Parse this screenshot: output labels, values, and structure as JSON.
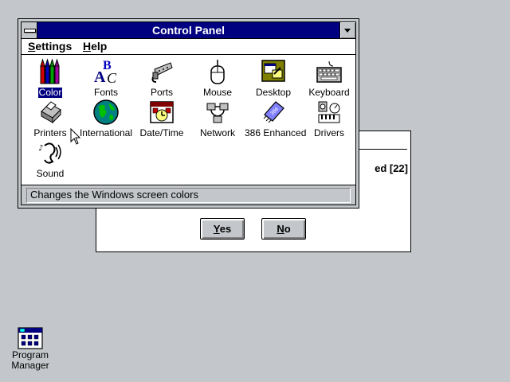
{
  "window": {
    "title": "Control Panel",
    "menus": [
      {
        "label": "Settings",
        "accel": "S",
        "rest": "ettings"
      },
      {
        "label": "Help",
        "accel": "H",
        "rest": "elp"
      }
    ],
    "status_text": "Changes the Windows screen colors"
  },
  "icons": [
    {
      "label": "Color",
      "name": "color-icon",
      "selected": true
    },
    {
      "label": "Fonts",
      "name": "fonts-icon"
    },
    {
      "label": "Ports",
      "name": "ports-icon"
    },
    {
      "label": "Mouse",
      "name": "mouse-icon"
    },
    {
      "label": "Desktop",
      "name": "desktop-icon"
    },
    {
      "label": "Keyboard",
      "name": "keyboard-icon"
    },
    {
      "label": "Printers",
      "name": "printers-icon"
    },
    {
      "label": "International",
      "name": "globe-icon"
    },
    {
      "label": "Date/Time",
      "name": "clock-icon"
    },
    {
      "label": "Network",
      "name": "network-icon"
    },
    {
      "label": "386 Enhanced",
      "name": "chip-icon"
    },
    {
      "label": "Drivers",
      "name": "drivers-icon"
    },
    {
      "label": "Sound",
      "name": "sound-icon"
    }
  ],
  "background_dialog": {
    "partial_text": "ed [22]",
    "yes": {
      "accel": "Y",
      "rest": "es"
    },
    "no": {
      "accel": "N",
      "rest": "o"
    }
  },
  "desktop": {
    "program_manager_line1": "Program",
    "program_manager_line2": "Manager"
  },
  "colors": {
    "desktop": "#c3c7cb",
    "titlebar": "#000080",
    "selection": "#000080"
  }
}
